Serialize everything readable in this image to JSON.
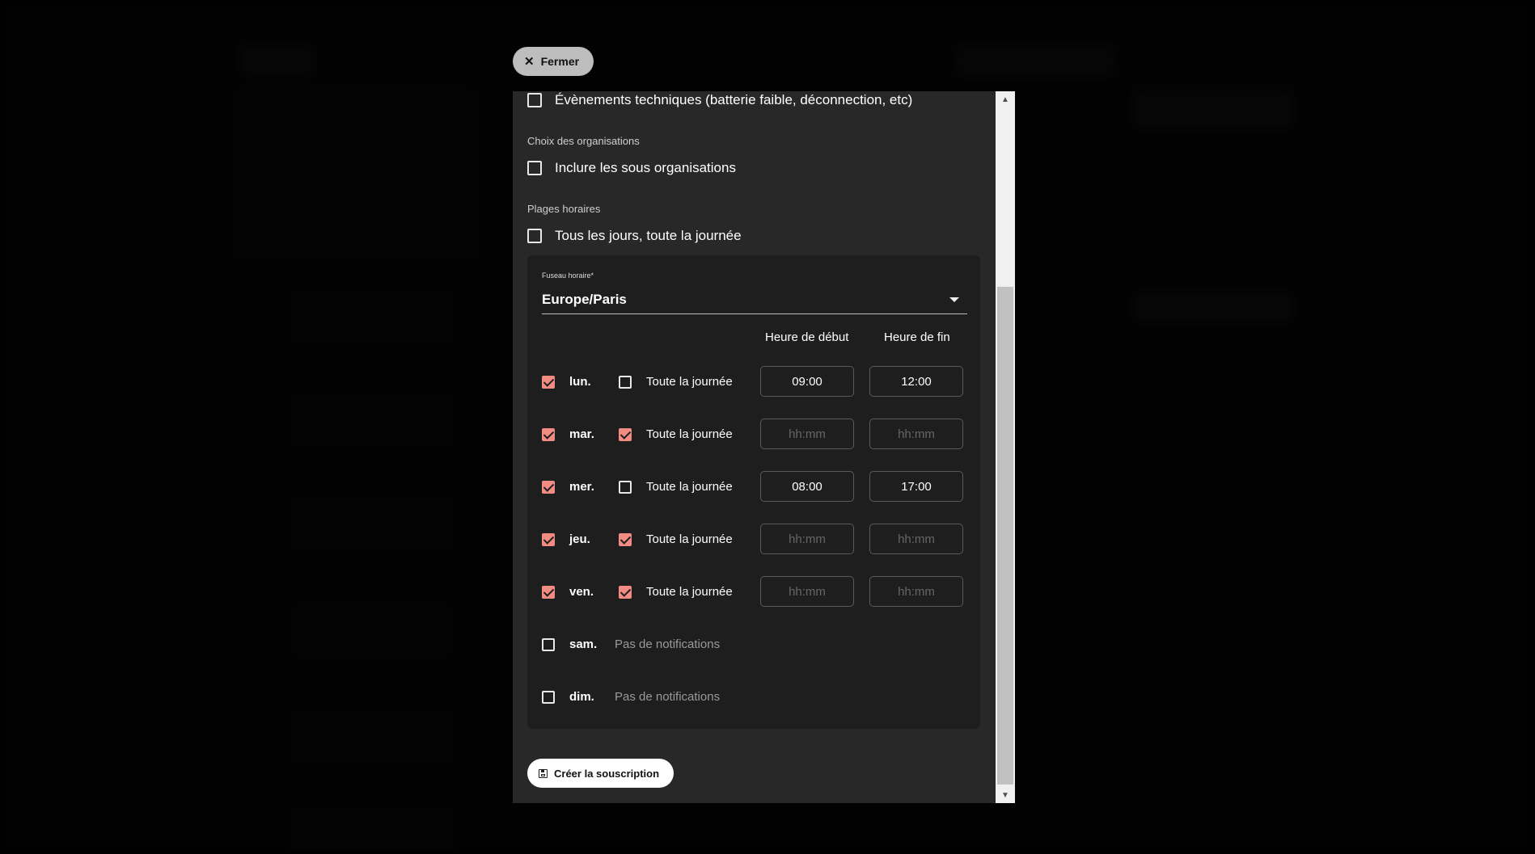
{
  "close_button": {
    "label": "Fermer",
    "icon": "close-icon"
  },
  "form": {
    "technical_events_label": "Évènements techniques (batterie faible, déconnection, etc)",
    "organisations_section": "Choix des organisations",
    "include_sub_orgs_label": "Inclure les sous organisations",
    "time_ranges_section": "Plages horaires",
    "every_day_label": "Tous les jours, toute la journée",
    "timezone": {
      "label": "Fuseau horaire*",
      "value": "Europe/Paris"
    },
    "columns": {
      "start": "Heure de début",
      "end": "Heure de fin"
    },
    "days": [
      {
        "label": "lun.",
        "checked": true,
        "all_day_label": "Toute la journée",
        "all_day": false,
        "start": "09:00",
        "end": "12:00"
      },
      {
        "label": "mar.",
        "checked": true,
        "all_day_label": "Toute la journée",
        "all_day": true,
        "start_placeholder": "hh:mm",
        "end_placeholder": "hh:mm"
      },
      {
        "label": "mer.",
        "checked": true,
        "all_day_label": "Toute la journée",
        "all_day": false,
        "start": "08:00",
        "end": "17:00"
      },
      {
        "label": "jeu.",
        "checked": true,
        "all_day_label": "Toute la journée",
        "all_day": true,
        "start_placeholder": "hh:mm",
        "end_placeholder": "hh:mm"
      },
      {
        "label": "ven.",
        "checked": true,
        "all_day_label": "Toute la journée",
        "all_day": true,
        "start_placeholder": "hh:mm",
        "end_placeholder": "hh:mm"
      },
      {
        "label": "sam.",
        "checked": false,
        "none_label": "Pas de notifications"
      },
      {
        "label": "dim.",
        "checked": false,
        "none_label": "Pas de notifications"
      }
    ],
    "submit_label": "Créer la souscription",
    "submit_icon": "save-icon"
  },
  "colors": {
    "accent": "#f28b82",
    "modal_bg": "#282828",
    "panel_bg": "#1e1e1e"
  }
}
